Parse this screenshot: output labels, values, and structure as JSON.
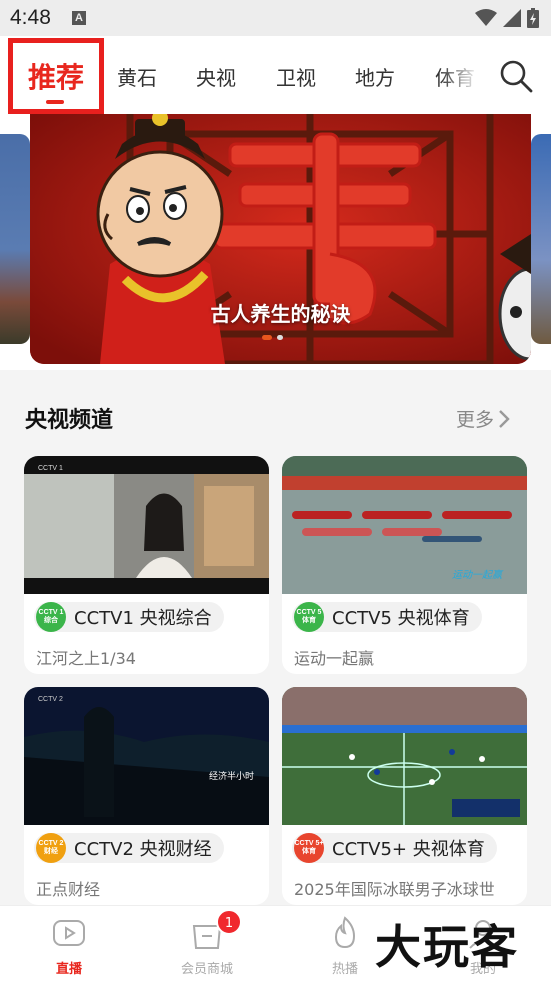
{
  "status": {
    "time": "4:48",
    "notif_icon": "A"
  },
  "nav": {
    "active_tab": "推荐",
    "tabs": [
      "黄石",
      "央视",
      "卫视",
      "地方",
      "体育"
    ]
  },
  "banner": {
    "caption": "古人养生的秘诀",
    "slide_index": 1,
    "slide_count": 2
  },
  "section": {
    "title": "央视频道",
    "more": "更多"
  },
  "channels": [
    {
      "name": "CCTV1 央视综合",
      "program": "江河之上1/34",
      "logo_top": "CCTV 1",
      "logo_bottom": "综合",
      "logo_color": "#3bb54a"
    },
    {
      "name": "CCTV5 央视体育",
      "program": "运动一起赢",
      "logo_top": "CCTV 5",
      "logo_bottom": "体育",
      "logo_color": "#3bb54a"
    },
    {
      "name": "CCTV2 央视财经",
      "program": "正点财经",
      "logo_top": "CCTV 2",
      "logo_bottom": "财经",
      "logo_color": "#f0a010"
    },
    {
      "name": "CCTV5+ 央视体育",
      "program": "2025年国际冰联男子冰球世",
      "logo_top": "CCTV 5+",
      "logo_bottom": "体育",
      "logo_color": "#e8452e"
    }
  ],
  "bottom_nav": [
    {
      "label": "直播",
      "icon": "play-tv-icon",
      "active": true
    },
    {
      "label": "会员商城",
      "icon": "shopping-bag-icon",
      "badge": "1"
    },
    {
      "label": "热播",
      "icon": "flame-icon"
    },
    {
      "label": "我的",
      "icon": "profile-icon"
    }
  ],
  "watermark": "大玩客",
  "colors": {
    "accent": "#e8271e",
    "badge": "#f0282d"
  }
}
